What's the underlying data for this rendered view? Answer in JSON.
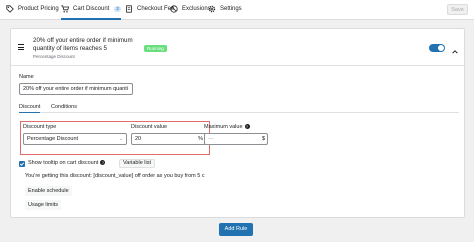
{
  "nav": {
    "tabs": [
      {
        "label": "Product Pricing",
        "icon": "tag-icon"
      },
      {
        "label": "Cart Discount",
        "icon": "cart-icon",
        "badge": "2"
      },
      {
        "label": "Checkout Fee",
        "icon": "receipt-icon"
      },
      {
        "label": "Exclusions",
        "icon": "exclusion-icon"
      },
      {
        "label": "Settings",
        "icon": "gear-icon"
      }
    ],
    "save_label": "Save"
  },
  "rule": {
    "title": "20% off your entire order if minimum quantity of items reaches 5",
    "type": "Percentage Discount",
    "status": "Running",
    "enabled": true
  },
  "form": {
    "name_label": "Name",
    "name_value": "20% off your entire order if minimum quanti",
    "subtabs": [
      "Discount",
      "Conditions"
    ],
    "discount_type_label": "Discount type",
    "discount_type_value": "Percentage Discount",
    "discount_value_label": "Discount value",
    "discount_value": "20",
    "discount_value_suffix": "%",
    "max_value_label": "Maximum value",
    "max_value_placeholder": "—",
    "max_value_suffix": "$",
    "tooltip_label": "Show tooltip on cart discount",
    "variable_list_label": "Variable list",
    "tooltip_text": "You're getting this discount: [discount_value] off order as you buy from 5 c",
    "enable_schedule_label": "Enable schedule",
    "usage_limits_label": "Usage limits"
  },
  "footer": {
    "add_rule_label": "Add Rule"
  },
  "colors": {
    "accent": "#2271b1",
    "running": "#68de7c",
    "highlight": "#e26b6b"
  }
}
